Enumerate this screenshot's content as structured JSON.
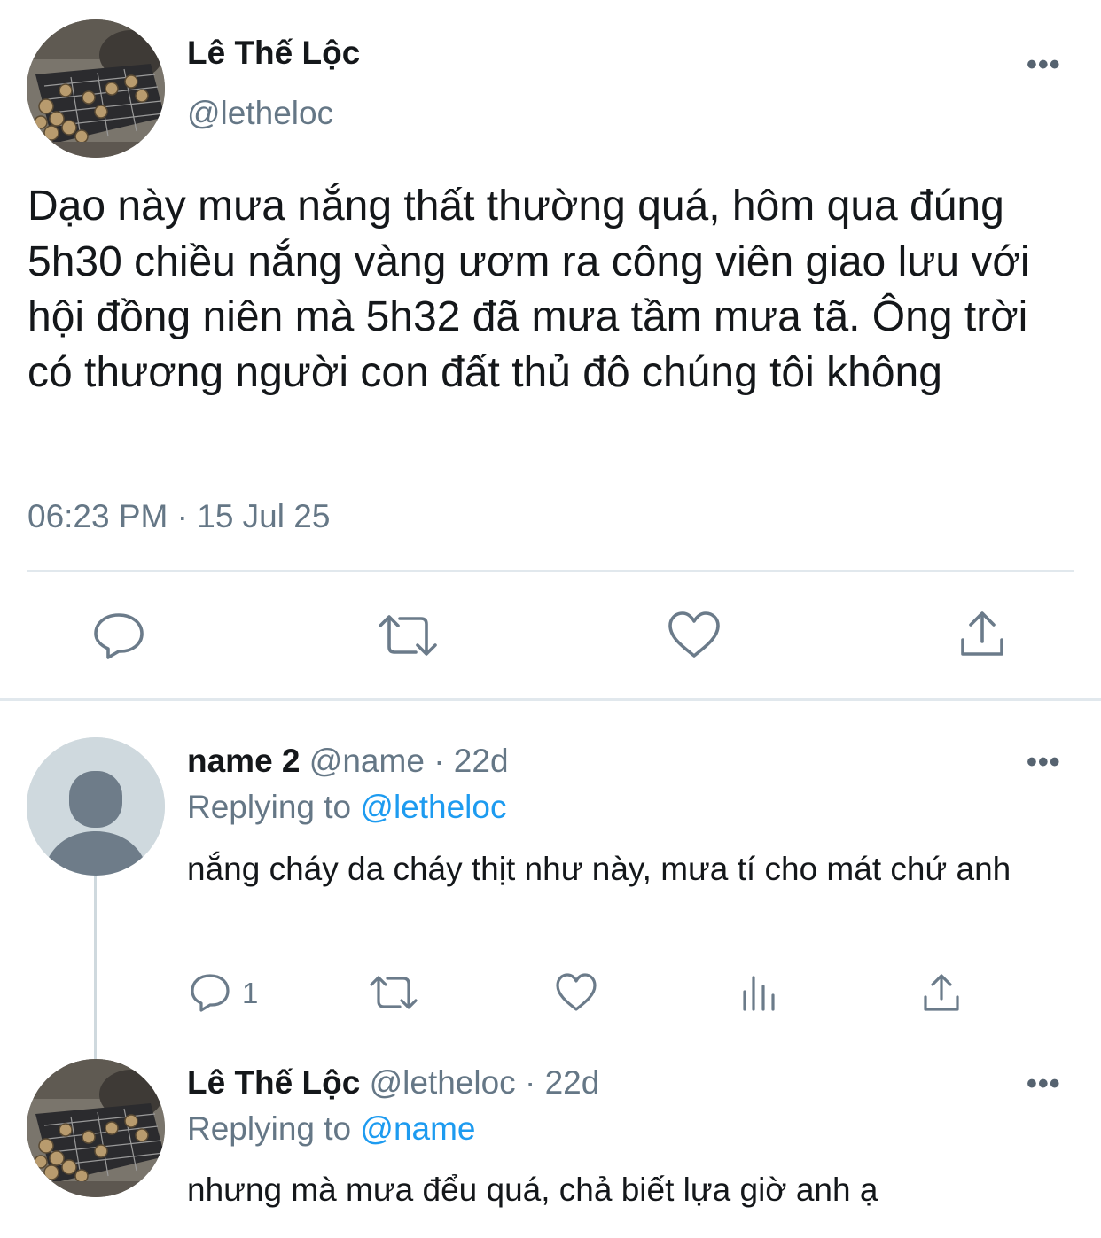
{
  "main_tweet": {
    "display_name": "Lê Thế Lộc",
    "handle": "@letheloc",
    "text": "Dạo này mưa nắng thất thường quá, hôm qua đúng 5h30 chiều nắng vàng ươm ra công viên giao lưu với hội đồng niên mà 5h32 đã mưa tầm mưa tã. Ông trời có thương người con đất thủ đô chúng tôi không",
    "timestamp": "06:23 PM · 15 Jul 25",
    "more_label": "•••",
    "actions": [
      "reply-icon",
      "retweet-icon",
      "like-icon",
      "share-icon"
    ]
  },
  "replies": [
    {
      "display_name": "name 2",
      "handle_time": "@name · 22d",
      "replying_prefix": "Replying to",
      "replying_handle": "@letheloc",
      "text": "nắng cháy da cháy thịt như này, mưa tí cho mát chứ anh",
      "reply_count": "1",
      "more_label": "•••",
      "actions": [
        "reply-icon",
        "retweet-icon",
        "like-icon",
        "analytics-icon",
        "share-icon"
      ]
    },
    {
      "display_name": "Lê Thế Lộc",
      "handle_time": "@letheloc · 22d",
      "replying_prefix": "Replying to",
      "replying_handle": "@name",
      "text": "nhưng mà mưa đểu quá, chả biết lựa giờ anh ạ",
      "more_label": "•••"
    }
  ],
  "colors": {
    "link": "#1d9bf0",
    "secondary_text": "#657786",
    "divider": "#e1e8ed",
    "icon": "#6b7b8a"
  }
}
